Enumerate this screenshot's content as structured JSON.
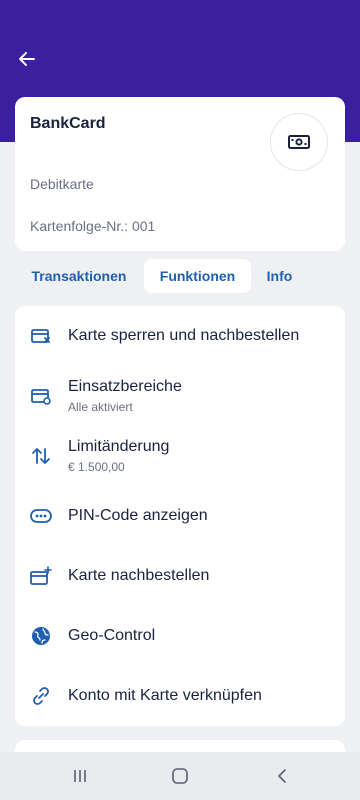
{
  "header": {
    "back_icon": "arrow-left-icon"
  },
  "card": {
    "title": "BankCard",
    "type": "Debitkarte",
    "sequence": "Kartenfolge-Nr.: 001",
    "icon": "cash-icon"
  },
  "tabs": [
    {
      "label": "Transaktionen",
      "active": false
    },
    {
      "label": "Funktionen",
      "active": true
    },
    {
      "label": "Info",
      "active": false
    }
  ],
  "menu": {
    "items": [
      {
        "label": "Karte sperren und nachbestellen",
        "sub": "",
        "icon": "card-block-icon"
      },
      {
        "label": "Einsatzbereiche",
        "sub": "Alle aktiviert",
        "icon": "card-settings-icon"
      },
      {
        "label": "Limitänderung",
        "sub": "€ 1.500,00",
        "icon": "swap-vertical-icon"
      },
      {
        "label": "PIN-Code anzeigen",
        "sub": "",
        "icon": "pin-dots-icon"
      },
      {
        "label": "Karte nachbestellen",
        "sub": "",
        "icon": "card-reorder-icon"
      },
      {
        "label": "Geo-Control",
        "sub": "",
        "icon": "globe-icon"
      },
      {
        "label": "Konto mit Karte verknüpfen",
        "sub": "",
        "icon": "link-icon"
      }
    ]
  },
  "colors": {
    "header": "#3a1f9e",
    "accent": "#1f5fb0",
    "text": "#1b2240",
    "muted": "#6b7086",
    "background": "#eef0f4"
  },
  "system_nav": {
    "recent": "recent-apps-icon",
    "home": "home-icon",
    "back": "back-icon"
  }
}
